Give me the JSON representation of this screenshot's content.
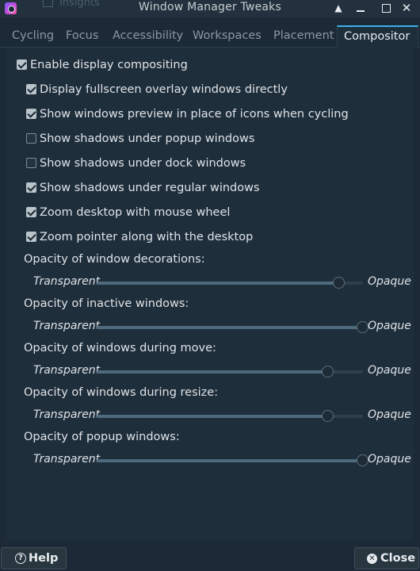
{
  "window": {
    "title": "Window Manager Tweaks",
    "background_tab_label": "Insights",
    "controls": {
      "up": "▲",
      "close": "✕"
    }
  },
  "tabs": [
    {
      "label": "Cycling",
      "active": false
    },
    {
      "label": "Focus",
      "active": false
    },
    {
      "label": "Accessibility",
      "active": false
    },
    {
      "label": "Workspaces",
      "active": false
    },
    {
      "label": "Placement",
      "active": false
    },
    {
      "label": "Compositor",
      "active": true
    }
  ],
  "compositor": {
    "enable": {
      "label": "Enable display compositing",
      "checked": true
    },
    "options": [
      {
        "label": "Display fullscreen overlay windows directly",
        "checked": true
      },
      {
        "label": "Show windows preview in place of icons when cycling",
        "checked": true
      },
      {
        "label": "Show shadows under popup windows",
        "checked": false
      },
      {
        "label": "Show shadows under dock windows",
        "checked": false
      },
      {
        "label": "Show shadows under regular windows",
        "checked": true
      },
      {
        "label": "Zoom desktop with mouse wheel",
        "checked": true
      },
      {
        "label": "Zoom pointer along with the desktop",
        "checked": true
      }
    ],
    "sliders": [
      {
        "label": "Opacity of window decorations:",
        "min_label": "Transparent",
        "max_label": "Opaque",
        "value": 0.91
      },
      {
        "label": "Opacity of inactive windows:",
        "min_label": "Transparent",
        "max_label": "Opaque",
        "value": 1.0
      },
      {
        "label": "Opacity of windows during move:",
        "min_label": "Transparent",
        "max_label": "Opaque",
        "value": 0.87
      },
      {
        "label": "Opacity of windows during resize:",
        "min_label": "Transparent",
        "max_label": "Opaque",
        "value": 0.87
      },
      {
        "label": "Opacity of popup windows:",
        "min_label": "Transparent",
        "max_label": "Opaque",
        "value": 1.0
      }
    ]
  },
  "buttons": {
    "help": {
      "label": "Help",
      "icon": "question-icon"
    },
    "close": {
      "label": "Close",
      "icon": "close-icon"
    }
  },
  "colors": {
    "accent": "#3daee9",
    "background": "#1b2a36",
    "panel": "#1e2e3b"
  }
}
